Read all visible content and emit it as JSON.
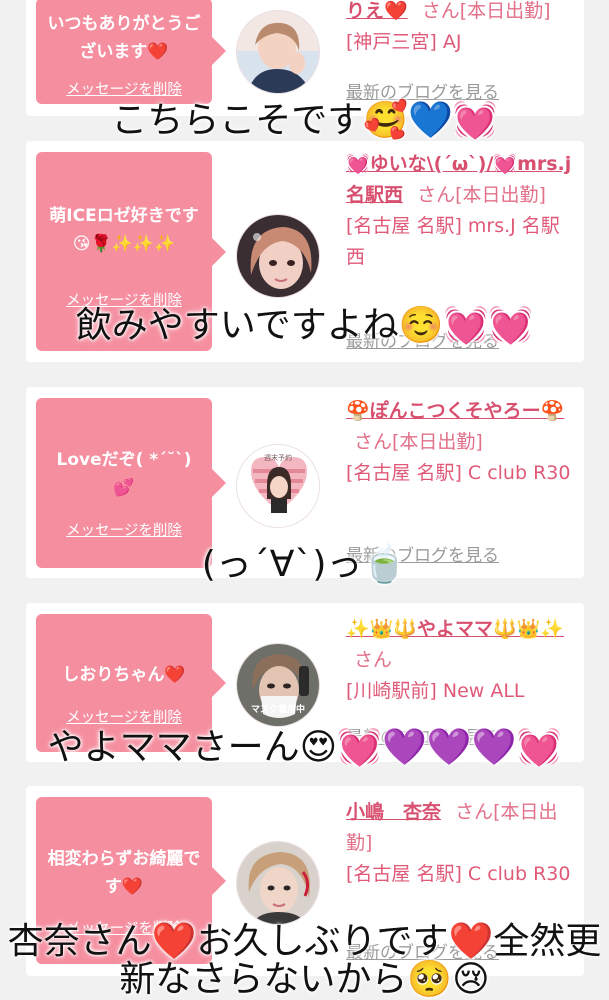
{
  "cards": [
    {
      "bubble_text": "いつもありがとうございます❤️",
      "delete_label": "メッセージを削除",
      "name": "りえ❤️",
      "san": "さん[本日出勤]",
      "shop": "[神戸三宮] AJ",
      "blog_link": "最新のブログを見る"
    },
    {
      "bubble_text": "萌ICEロゼ好きです😘🌹✨✨✨",
      "delete_label": "メッセージを削除",
      "name": "💓ゆいな\\(´ω`)/💓mrs.j名駅西",
      "san": "さん[本日出勤]",
      "shop": "[名古屋 名駅] mrs.J 名駅西",
      "blog_link": "最新のブログを見る"
    },
    {
      "bubble_text": "Loveだぞ( *´˘`)💕",
      "delete_label": "メッセージを削除",
      "name": "🍄ぽんこつくそやろー🍄",
      "san": "さん[本日出勤]",
      "shop": "[名古屋 名駅] C club R30",
      "blog_link": "最新のブログを見る"
    },
    {
      "bubble_text": "しおりちゃん❤️",
      "delete_label": "メッセージを削除",
      "name": "✨👑🔱やよママ🔱👑✨",
      "san": "さん",
      "shop": "[川崎駅前] New ALL",
      "blog_link": "最新のブログを見る"
    },
    {
      "bubble_text": "相変わらずお綺麗です❤️",
      "delete_label": "メッセージを削除",
      "name": "小嶋　杏奈",
      "san": "さん[本日出勤]",
      "shop": "[名古屋 名駅] C club R30",
      "blog_link": "最新のブログを見る"
    }
  ],
  "captions": [
    "こちらこそです🥰💙💓",
    "飲みやすいですよね☺️💓💓",
    "(っ´∀`)っ🍵",
    "やよママさーん😍💓💜💜💜💓",
    "杏奈さん❤️お久しぶりです❤️全然更",
    "新なさらないから🥺😢"
  ],
  "avatar_badges": {
    "card3": "週末予約",
    "card4": "マスク着用中"
  },
  "colors": {
    "bubble": "#f58fa0",
    "name": "#d8506f",
    "shop": "#e05a78",
    "background": "#f1f1f1"
  }
}
